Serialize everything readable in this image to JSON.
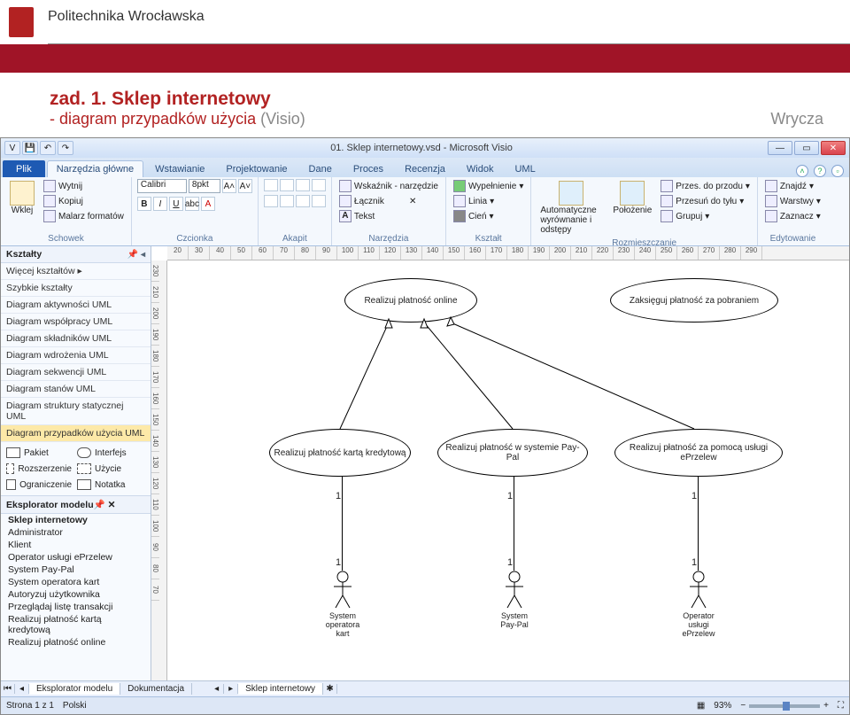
{
  "slide": {
    "university": "Politechnika Wrocławska",
    "title_l1": "zad. 1. Sklep internetowy",
    "title_l2_a": "- diagram przypadków użycia ",
    "title_l2_b": "(Visio)",
    "author": "Wrycza"
  },
  "window": {
    "title": "01. Sklep internetowy.vsd - Microsoft Visio",
    "qa": {
      "save": "💾",
      "undo": "↶",
      "redo": "↷"
    },
    "help_tip": "?"
  },
  "tabs": {
    "file": "Plik",
    "items": [
      "Narzędzia główne",
      "Wstawianie",
      "Projektowanie",
      "Dane",
      "Proces",
      "Recenzja",
      "Widok",
      "UML"
    ],
    "active": 0
  },
  "ribbon": {
    "clipboard": {
      "paste": "Wklej",
      "cut": "Wytnij",
      "copy": "Kopiuj",
      "painter": "Malarz formatów",
      "label": "Schowek"
    },
    "font": {
      "name": "Calibri",
      "size": "8pkt",
      "label": "Czcionka"
    },
    "para": {
      "label": "Akapit"
    },
    "tools": {
      "pointer": "Wskaźnik - narzędzie",
      "connector": "Łącznik",
      "text": "Tekst",
      "x": "✕",
      "label": "Narzędzia"
    },
    "shape": {
      "fill": "Wypełnienie",
      "line": "Linia",
      "shadow": "Cień",
      "label": "Kształt"
    },
    "arrange": {
      "align": "Automatyczne wyrównanie i odstępy",
      "position": "Położenie",
      "front": "Przes. do przodu",
      "back": "Przesuń do tyłu",
      "group": "Grupuj",
      "label": "Rozmieszczanie"
    },
    "editing": {
      "find": "Znajdź",
      "layers": "Warstwy",
      "select": "Zaznacz",
      "label": "Edytowanie"
    }
  },
  "shapes_pane": {
    "title": "Kształty",
    "more": "Więcej kształtów",
    "quick": "Szybkie kształty",
    "stencils": [
      "Diagram aktywności UML",
      "Diagram współpracy UML",
      "Diagram składników UML",
      "Diagram wdrożenia UML",
      "Diagram sekwencji UML",
      "Diagram stanów UML",
      "Diagram struktury statycznej UML",
      "Diagram przypadków użycia UML"
    ],
    "selected": 7,
    "shapes": [
      {
        "n": "Pakiet"
      },
      {
        "n": "Interfejs"
      },
      {
        "n": "Rozszerzenie"
      },
      {
        "n": "Użycie"
      },
      {
        "n": "Ograniczenie"
      },
      {
        "n": "Notatka"
      }
    ]
  },
  "explorer": {
    "title": "Eksplorator modelu",
    "items": [
      "Sklep internetowy",
      "Administrator",
      "Klient",
      "Operator usługi ePrzelew",
      "System Pay-Pal",
      "System operatora kart",
      "Autoryzuj użytkownika",
      "Przeglądaj listę transakcji",
      "Realizuj płatność kartą kredytową",
      "Realizuj płatność online"
    ]
  },
  "canvas": {
    "ruler_h": [
      "20",
      "30",
      "40",
      "50",
      "60",
      "70",
      "80",
      "90",
      "100",
      "110",
      "120",
      "130",
      "140",
      "150",
      "160",
      "170",
      "180",
      "190",
      "200",
      "210",
      "220",
      "230",
      "240",
      "250",
      "260",
      "270",
      "280",
      "290"
    ],
    "ruler_v": [
      "230",
      "210",
      "200",
      "190",
      "180",
      "170",
      "160",
      "150",
      "140",
      "130",
      "120",
      "110",
      "100",
      "90",
      "80",
      "70"
    ],
    "uc_top": "Realizuj płatność online",
    "uc_tr": "Zaksięguj płatność za pobraniem",
    "uc_m1": "Realizuj płatność kartą kredytową",
    "uc_m2": "Realizuj płatność w systemie Pay-Pal",
    "uc_m3": "Realizuj płatność za pomocą usługi ePrzelew",
    "actor1": "System operatora kart",
    "actor2": "System Pay-Pal",
    "actor3": "Operator usługi ePrzelew",
    "one": "1"
  },
  "bottom_tabs": {
    "t1": "Eksplorator modelu",
    "t2": "Dokumentacja",
    "page": "Sklep internetowy"
  },
  "status": {
    "page": "Strona 1 z 1",
    "lang": "Polski",
    "zoom": "93%"
  }
}
